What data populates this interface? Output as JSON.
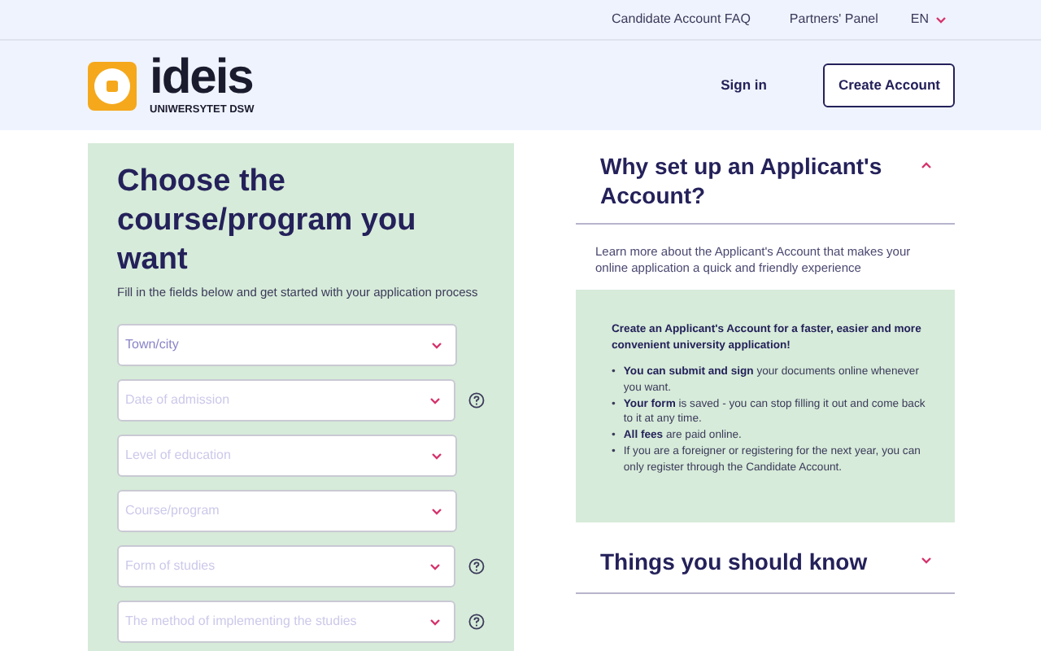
{
  "top_links": [
    "Candidate Account FAQ",
    "Partners' Panel"
  ],
  "language": {
    "label": "EN",
    "expanded": false
  },
  "logo": {
    "name": "ideis",
    "subtitle": "UNIWERSYTET DSW"
  },
  "header_actions": {
    "sign_in": "Sign in",
    "create_account": "Create Account"
  },
  "form": {
    "title": "Choose the course/program you want",
    "subtitle": "Fill in the fields below and get started with your application process",
    "fields": [
      {
        "placeholder": "Town/city",
        "disabled": false,
        "help": false
      },
      {
        "placeholder": "Date of admission",
        "disabled": true,
        "help": true
      },
      {
        "placeholder": "Level of education",
        "disabled": true,
        "help": false
      },
      {
        "placeholder": "Course/program",
        "disabled": true,
        "help": false
      },
      {
        "placeholder": "Form of studies",
        "disabled": true,
        "help": true
      },
      {
        "placeholder": "The method of implementing the studies",
        "disabled": true,
        "help": true
      }
    ]
  },
  "accordion": [
    {
      "title": "Why set up an Applicant's Account?",
      "expanded": true,
      "intro": "Learn more about the Applicant's Account that makes your online application a quick and friendly experience",
      "box_title": "Create an Applicant's Account for a faster, easier and more convenient university application!",
      "bullets": [
        {
          "marker": "•",
          "text": "**You can submit and sign** your documents online whenever you want."
        },
        {
          "marker": "•",
          "text": "**Your form** is saved - you can stop filling it out and come back to it at any time."
        },
        {
          "marker": "•",
          "text": "**All fees** are paid online."
        },
        {
          "marker": "•",
          "text": "If you are a foreigner or registering for the next year, you can only register through the Candidate Account."
        }
      ]
    },
    {
      "title": "Things you should know",
      "expanded": false
    }
  ]
}
